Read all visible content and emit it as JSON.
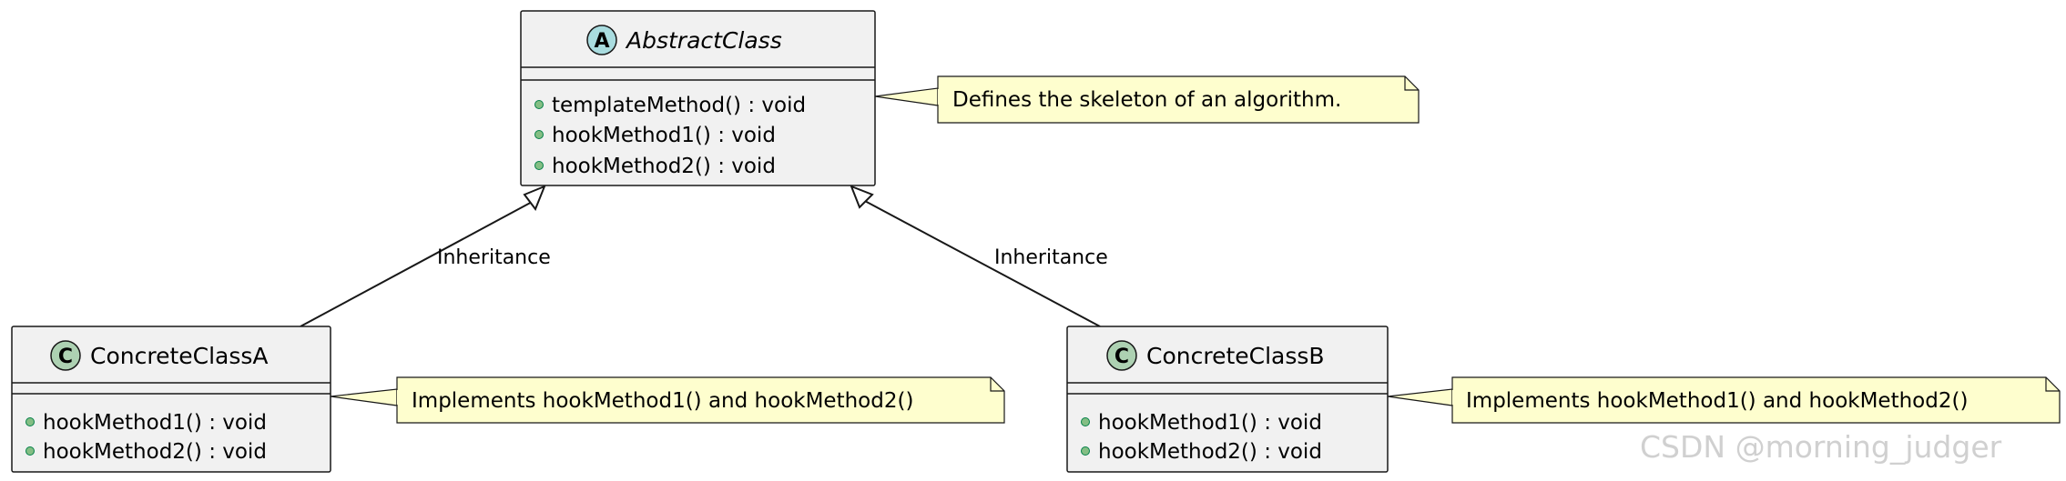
{
  "abstract_class": {
    "stereotype_letter": "A",
    "name": "AbstractClass",
    "methods": [
      "templateMethod() : void",
      "hookMethod1() : void",
      "hookMethod2() : void"
    ],
    "note": "Defines the skeleton of an algorithm."
  },
  "concrete_a": {
    "stereotype_letter": "C",
    "name": "ConcreteClassA",
    "methods": [
      "hookMethod1() : void",
      "hookMethod2() : void"
    ],
    "note": "Implements hookMethod1() and hookMethod2()"
  },
  "concrete_b": {
    "stereotype_letter": "C",
    "name": "ConcreteClassB",
    "methods": [
      "hookMethod1() : void",
      "hookMethod2() : void"
    ],
    "note": "Implements hookMethod1() and hookMethod2()"
  },
  "relations": [
    {
      "label": "Inheritance",
      "from": "ConcreteClassA",
      "to": "AbstractClass"
    },
    {
      "label": "Inheritance",
      "from": "ConcreteClassB",
      "to": "AbstractClass"
    }
  ],
  "colors": {
    "abstract_badge": "#a9dcdf",
    "class_badge": "#add1b2",
    "note_fill": "#fefece",
    "box_fill": "#f1f1f1",
    "method_dot": "#84be84"
  },
  "watermark": "CSDN @morning_judger"
}
